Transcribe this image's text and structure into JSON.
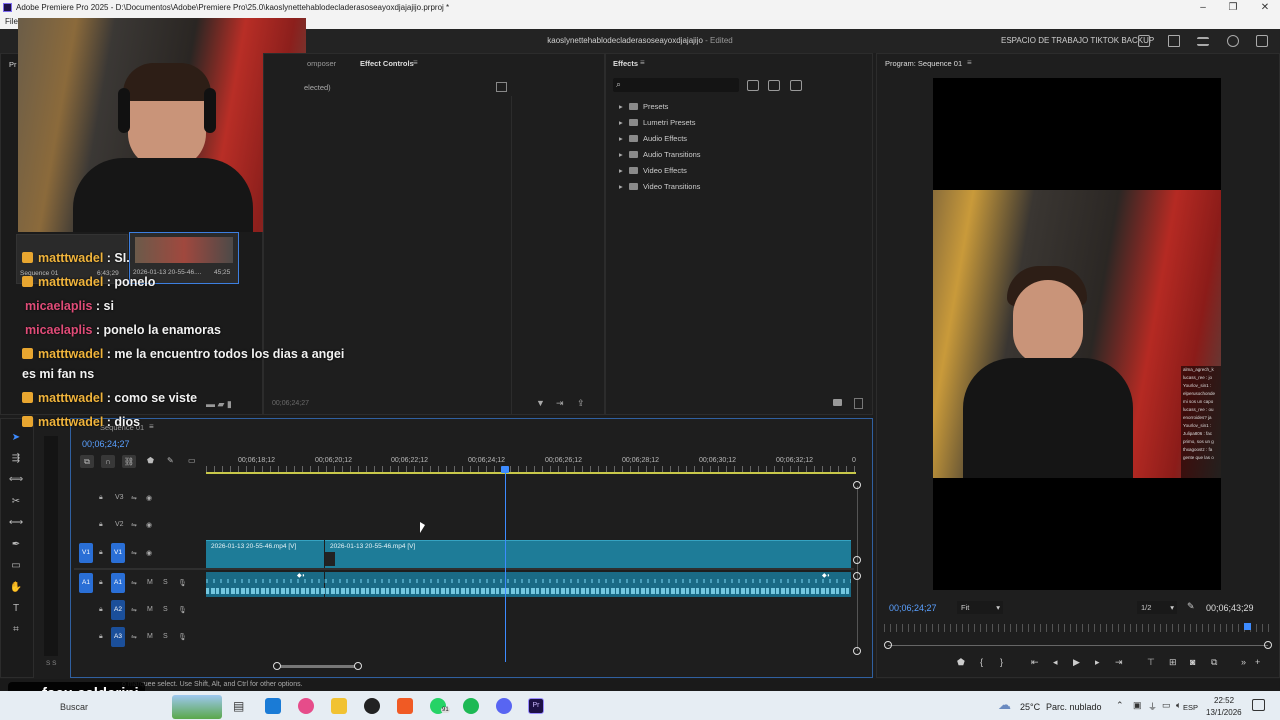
{
  "window": {
    "title": "Adobe Premiere Pro 2025 - D:\\Documentos\\Adobe\\Premiere Pro\\25.0\\kaoslynettehablodecladerasoseayoxdjajajijo.prproj *",
    "menu_first": "File"
  },
  "header": {
    "doc_title": "kaoslynettehablodecladerasoseayoxdjajajijo",
    "edited": " - Edited",
    "workspace": "ESPACIO DE TRABAJO TIKTOK BACKUP"
  },
  "source_panel": {
    "tab_composer": "omposer",
    "tab_effect_controls": "Effect Controls",
    "no_selection": "elected)",
    "timecode": "00;06;24;27"
  },
  "project_panel": {
    "tab_label": "Pr",
    "item1_name": "Sequence 01",
    "item1_duration": "6;43;29",
    "item2_name": "2026-01-13 20-55-46....",
    "item2_duration": "45;25"
  },
  "effects": {
    "tab": "Effects",
    "items": [
      "Presets",
      "Lumetri Presets",
      "Audio Effects",
      "Audio Transitions",
      "Video Effects",
      "Video Transitions"
    ]
  },
  "program": {
    "tab": "Program: Sequence 01",
    "current_tc": "00;06;24;27",
    "fit": "Fit",
    "resolution": "1/2",
    "duration_tc": "00;06;43;29",
    "overlay_chat": [
      "alma_agrech_k",
      "lucass_ree : jo",
      "Yourlov_sin1 :",
      "elperusochonde",
      "mi sos un capo",
      "lucass_ree : ou",
      "enorroides? ja",
      "Yourlov_sin1 :",
      "Julipa806 : fac",
      "primo, sos un g",
      "thxagoostz : fa",
      "gente que las o"
    ]
  },
  "timeline": {
    "tab": "Sequence 01",
    "timecode": "00;06;24;27",
    "ruler": [
      "00;06;18;12",
      "00;06;20;12",
      "00;06;22;12",
      "00;06;24;12",
      "00;06;26;12",
      "00;06;28;12",
      "00;06;30;12",
      "00;06;32;12",
      "0"
    ],
    "tracks": {
      "v3": "V3",
      "v2": "V2",
      "v1": "V1",
      "a1": "A1",
      "a2": "A2",
      "a3": "A3",
      "m": "M",
      "s": "S"
    },
    "clip1": "2026-01-13 20-55-46.mp4 [V]",
    "clip2": "2026-01-13 20-55-46.mp4 [V]"
  },
  "chat": [
    {
      "user": "matttwadel",
      "msg": ": SI.",
      "color": "#f0b43c",
      "crown": true
    },
    {
      "user": "matttwadel",
      "msg": ": ponelo",
      "color": "#f0b43c",
      "crown": true
    },
    {
      "user": "micaelaplis",
      "msg": ": si",
      "color": "#e04c78",
      "crown": false
    },
    {
      "user": "micaelaplis",
      "msg": ": ponelo la enamoras",
      "color": "#e04c78",
      "crown": false
    },
    {
      "user": "matttwadel",
      "msg": ": me la encuentro todos los dias a angei",
      "color": "#f0b43c",
      "crown": true
    },
    {
      "user": "",
      "msg": "es mi fan ns",
      "color": "#f2f2f2",
      "crown": false
    },
    {
      "user": "matttwadel",
      "msg": ": como se viste",
      "color": "#f0b43c",
      "crown": true
    },
    {
      "user": "matttwadel",
      "msg": ": dios",
      "color": "#f0b43c",
      "crown": true
    }
  ],
  "status_bar": {
    "hint": "o marquee select. Use Shift, Alt, and Ctrl for other options."
  },
  "overlay": {
    "tiktok_user": "facu.calderini"
  },
  "taskbar": {
    "search": "Buscar",
    "weather_temp": "25°C",
    "weather_desc": "Parc. nublado",
    "lang": "ESP",
    "time": "22:52",
    "date": "13/1/2026",
    "whatsapp_badge": "91"
  },
  "colors": {
    "accent": "#2a6fd6",
    "clip": "#1e7c98",
    "timecode": "#5aa0ff"
  }
}
